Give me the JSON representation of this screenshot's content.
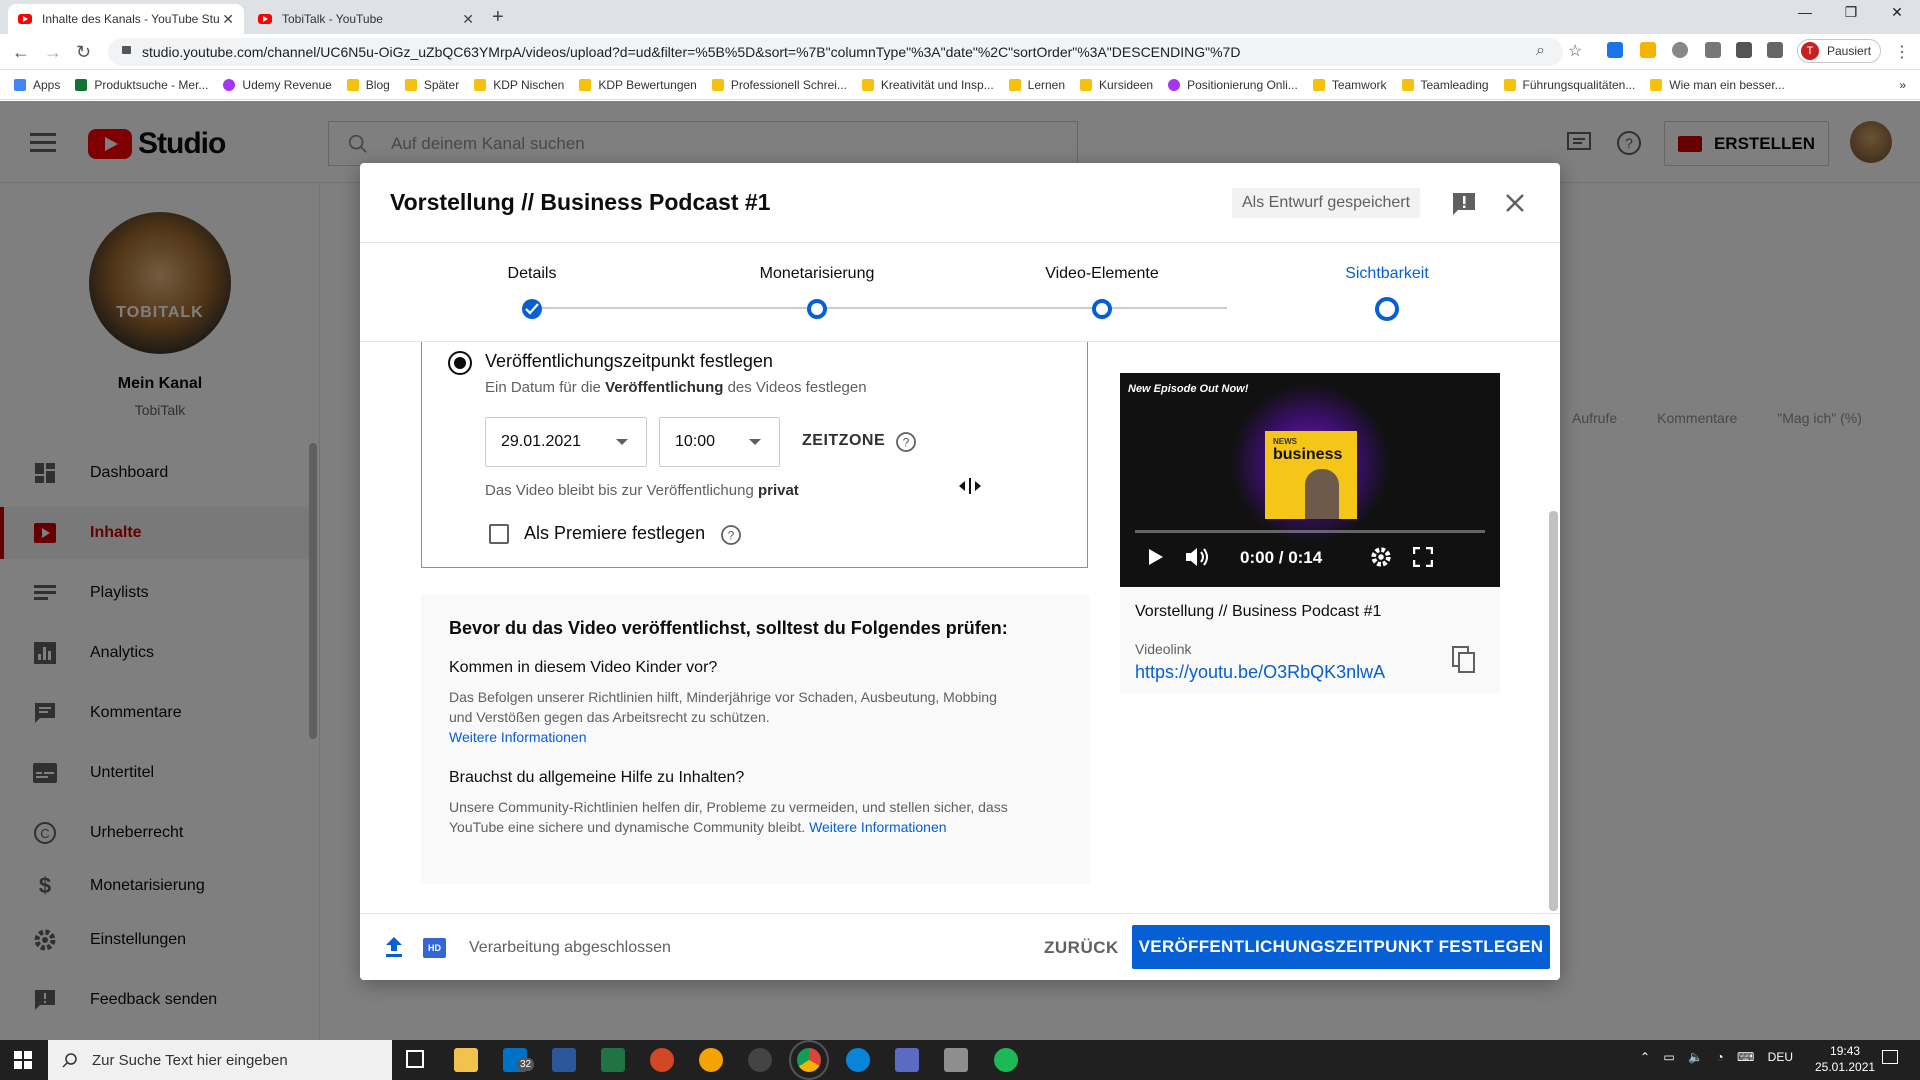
{
  "browser": {
    "tabs": [
      {
        "label": "Inhalte des Kanals - YouTube Stu",
        "active": true
      },
      {
        "label": "TobiTalk - YouTube",
        "active": false
      }
    ],
    "url": "studio.youtube.com/channel/UC6N5u-OiGz_uZbQC63YMrpA/videos/upload?d=ud&filter=%5B%5D&sort=%7B\"columnType\"%3A\"date\"%2C\"sortOrder\"%3A\"DESCENDING\"%7D",
    "profile_status": "Pausiert",
    "profile_initial": "T",
    "bookmarks": [
      "Apps",
      "Produktsuche - Mer...",
      "Udemy Revenue",
      "Blog",
      "Später",
      "KDP Nischen",
      "KDP Bewertungen",
      "Professionell Schrei...",
      "Kreativität und Insp...",
      "Lernen",
      "Kursideen",
      "Positionierung Onli...",
      "Teamwork",
      "Teamleading",
      "Führungsqualitäten...",
      "Wie man ein besser..."
    ]
  },
  "studio": {
    "logo_text": "Studio",
    "search_placeholder": "Auf deinem Kanal suchen",
    "create_label": "ERSTELLEN"
  },
  "sidebar": {
    "avatar_text": "TOBITALK",
    "channel_label": "Mein Kanal",
    "channel_name": "TobiTalk",
    "items": [
      {
        "label": "Dashboard",
        "icon": "dashboard-icon"
      },
      {
        "label": "Inhalte",
        "icon": "content-icon",
        "active": true
      },
      {
        "label": "Playlists",
        "icon": "playlist-icon"
      },
      {
        "label": "Analytics",
        "icon": "analytics-icon"
      },
      {
        "label": "Kommentare",
        "icon": "comments-icon"
      },
      {
        "label": "Untertitel",
        "icon": "subtitles-icon"
      },
      {
        "label": "Urheberrecht",
        "icon": "copyright-icon"
      },
      {
        "label": "Monetarisierung",
        "icon": "dollar-icon"
      },
      {
        "label": "Einstellungen",
        "icon": "gear-icon"
      },
      {
        "label": "Feedback senden",
        "icon": "feedback-icon"
      }
    ]
  },
  "background_columns": [
    "Aufrufe",
    "Kommentare",
    "\"Mag ich\" (%)"
  ],
  "dialog": {
    "title": "Vorstellung // Business Podcast #1",
    "draft_status": "Als Entwurf gespeichert",
    "steps": [
      {
        "label": "Details",
        "state": "done"
      },
      {
        "label": "Monetarisierung",
        "state": "todo"
      },
      {
        "label": "Video-Elemente",
        "state": "todo"
      },
      {
        "label": "Sichtbarkeit",
        "state": "current"
      }
    ],
    "schedule": {
      "title": "Veröffentlichungszeitpunkt festlegen",
      "desc_pre": "Ein Datum für die ",
      "desc_bold": "Veröffentlichung",
      "desc_post": " des Videos festlegen",
      "date": "29.01.2021",
      "time": "10:00",
      "timezone_label": "ZEITZONE",
      "private_pre": "Das Video bleibt bis zur Veröffentlichung ",
      "private_bold": "privat",
      "premiere_label": "Als Premiere festlegen"
    },
    "checklist": {
      "title": "Bevor du das Video veröffentlichst, solltest du Folgendes prüfen:",
      "q1": "Kommen in diesem Video Kinder vor?",
      "a1": "Das Befolgen unserer Richtlinien hilft, Minderjährige vor Schaden, Ausbeutung, Mobbing und Verstößen gegen das Arbeitsrecht zu schützen.",
      "a1_link": "Weitere Informationen",
      "q2": "Brauchst du allgemeine Hilfe zu Inhalten?",
      "a2": "Unsere Community-Richtlinien helfen dir, Probleme zu vermeiden, und stellen sicher, dass YouTube eine sichere und dynamische Community bleibt.",
      "a2_link": "Weitere Informationen"
    },
    "preview": {
      "overlay_text": "New Episode Out Now!",
      "cover_small": "NEWS",
      "cover_big": "business",
      "time": "0:00 / 0:14",
      "progress": 0,
      "title": "Vorstellung // Business Podcast #1",
      "link_label": "Videolink",
      "link": "https://youtu.be/O3RbQK3nlwA"
    },
    "footer": {
      "hd_badge": "HD",
      "status": "Verarbeitung abgeschlossen",
      "back_label": "ZURÜCK",
      "publish_label": "VERÖFFENTLICHUNGSZEITPUNKT FESTLEGEN"
    }
  },
  "taskbar": {
    "search_placeholder": "Zur Suche Text hier eingeben",
    "mail_badge": "32",
    "language": "DEU",
    "time": "19:43",
    "date": "25.01.2021"
  },
  "colors": {
    "accent": "#065fd4",
    "brand": "#ff0000",
    "active_nav": "#cc0000"
  }
}
